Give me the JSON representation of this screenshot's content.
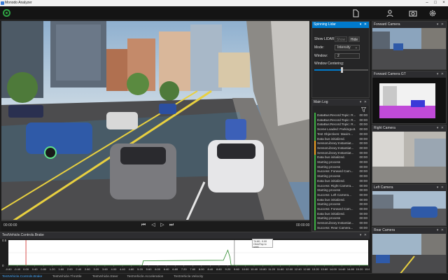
{
  "app": {
    "title": "Monodo Analyzer"
  },
  "toolbar": {
    "icons": [
      "document-icon",
      "user-icon",
      "camera-icon",
      "gear-icon"
    ]
  },
  "player": {
    "time_start": "00:00:00",
    "time_end": "00:00:00",
    "progress": 0.0
  },
  "lidar": {
    "title": "Spinning Lidar",
    "show_label": "Show LIDAR:",
    "show_btn": "Show",
    "hide_btn": "Hide",
    "mode_label": "Mode:",
    "mode_value": "Intensity",
    "window_label": "Window:",
    "window_value": "2",
    "centering_label": "Window Centering:",
    "centering_value": 0.5
  },
  "log": {
    "title": "Main Log",
    "entries": [
      {
        "msg": "DataBus:Record:Topic: R...",
        "time": "00:00",
        "color": "#3cb043"
      },
      {
        "msg": "DataBus:Record:Topic: R...",
        "time": "00:00",
        "color": "#3cb043"
      },
      {
        "msg": "DataBus:Record:Topic: R...",
        "time": "00:00",
        "color": "#3cb043"
      },
      {
        "msg": "Scene Loaded: ParkingLot...",
        "time": "00:00",
        "color": "#3cb043"
      },
      {
        "msg": "Test Objectives:  Maxim...",
        "time": "00:00",
        "color": "#3cb043"
      },
      {
        "msg": "Data bus initialized.",
        "time": "00:00",
        "color": "#3cb043"
      },
      {
        "msg": "SensorLibrary:Instantiat...",
        "time": "00:00",
        "color": "#f0a020"
      },
      {
        "msg": "SensorLibrary:Instantiat...",
        "time": "00:00",
        "color": "#f0a020"
      },
      {
        "msg": "SensorLibrary:Instantiat...",
        "time": "00:00",
        "color": "#f0a020"
      },
      {
        "msg": "Data bus initialized.",
        "time": "00:00",
        "color": "#3cb043"
      },
      {
        "msg": "Starting process",
        "time": "00:00",
        "color": "#3cb043"
      },
      {
        "msg": "Starting process",
        "time": "00:00",
        "color": "#3cb043"
      },
      {
        "msg": "Success: Forward Cam...",
        "time": "00:00",
        "color": "#3cb043"
      },
      {
        "msg": "Starting process",
        "time": "00:00",
        "color": "#3cb043"
      },
      {
        "msg": "Data bus initialized.",
        "time": "00:00",
        "color": "#3cb043"
      },
      {
        "msg": "Success: Right Camera...",
        "time": "00:00",
        "color": "#3cb043"
      },
      {
        "msg": "Starting process",
        "time": "00:00",
        "color": "#3cb043"
      },
      {
        "msg": "Success: Left Camera...",
        "time": "00:00",
        "color": "#3cb043"
      },
      {
        "msg": "Data bus initialized.",
        "time": "00:00",
        "color": "#3cb043"
      },
      {
        "msg": "Starting process",
        "time": "00:00",
        "color": "#3cb043"
      },
      {
        "msg": "Success: Forward Cam...",
        "time": "00:00",
        "color": "#3cb043"
      },
      {
        "msg": "Data bus initialized.",
        "time": "00:00",
        "color": "#3cb043"
      },
      {
        "msg": "Starting process",
        "time": "00:00",
        "color": "#3cb043"
      },
      {
        "msg": "SensorLibrary:Instantiat...",
        "time": "00:00",
        "color": "#3cb043"
      },
      {
        "msg": "Success: Rear Camera...",
        "time": "00:00",
        "color": "#3cb043"
      }
    ]
  },
  "cameras": [
    {
      "title": "Forward Camera"
    },
    {
      "title": "Forward Camera GT"
    },
    {
      "title": "Right Camera"
    },
    {
      "title": "Left Camera"
    },
    {
      "title": "Rear Camera"
    }
  ],
  "plot": {
    "title": "TestVehicle.Controls.Brake",
    "tooltip_line1": "T4.80 : 0.00",
    "tooltip_line2": "Click/Tap to seek"
  },
  "chart_data": {
    "type": "line",
    "title": "TestVehicle.Controls.Brake",
    "xlim": [
      -0.8,
      15.6
    ],
    "ylim": [
      0,
      0.5
    ],
    "x_ticks": [
      "-0.80",
      "-0.40",
      "0.00",
      "0.40",
      "0.80",
      "1.20",
      "1.60",
      "2.00",
      "2.40",
      "2.80",
      "3.20",
      "3.60",
      "4.00",
      "4.40",
      "4.80",
      "5.20",
      "5.60",
      "6.00",
      "6.40",
      "6.80",
      "7.20",
      "7.60",
      "8.00",
      "8.40",
      "8.80",
      "9.20",
      "9.60",
      "10.00",
      "10.40",
      "10.80",
      "11.20",
      "11.60",
      "12.00",
      "12.40",
      "12.80",
      "13.20",
      "13.60",
      "14.00",
      "14.40",
      "14.80",
      "15.20",
      "15.60"
    ],
    "y_ticks": [
      "0.5",
      "0"
    ],
    "series": [
      {
        "color": "#2e8b2e",
        "x": [
          -0.8,
          5.3,
          5.35,
          9.0,
          9.2,
          9.3,
          9.35,
          15.6
        ],
        "y": [
          0,
          0,
          0.09,
          0.1,
          0.3,
          0.16,
          0,
          0
        ]
      }
    ],
    "markers": [
      {
        "x": 0.0,
        "color": "#d9534f"
      },
      {
        "x": 9.5,
        "color": "#999999"
      }
    ]
  },
  "tabs": [
    {
      "label": "TestVehicle.Controls.Brake",
      "active": true
    },
    {
      "label": "TestVehicle.Throttle",
      "active": false
    },
    {
      "label": "TestVehicle.Steer",
      "active": false
    },
    {
      "label": "TestVehicle.Acceleration",
      "active": false
    },
    {
      "label": "TestVehicle.Velocity",
      "active": false
    }
  ]
}
